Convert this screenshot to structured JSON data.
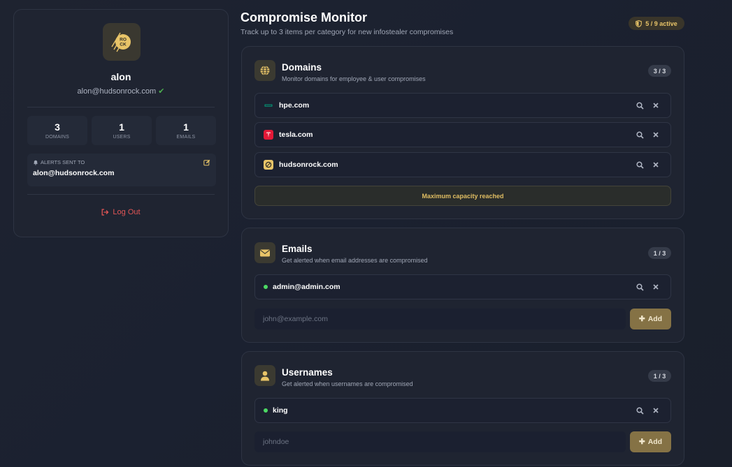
{
  "profile": {
    "name": "alon",
    "email": "alon@hudsonrock.com",
    "verified_icon": "check-icon",
    "logo_text": "ROCK",
    "stats": [
      {
        "value": "3",
        "label": "DOMAINS"
      },
      {
        "value": "1",
        "label": "USERS"
      },
      {
        "value": "1",
        "label": "EMAILS"
      }
    ],
    "alerts_label": "ALERTS SENT TO",
    "alerts_email": "alon@hudsonrock.com",
    "logout_label": "Log Out"
  },
  "header": {
    "title": "Compromise Monitor",
    "subtitle": "Track up to 3 items per category for new infostealer compromises",
    "active_badge": "5 / 9 active"
  },
  "domains": {
    "title": "Domains",
    "description": "Monitor domains for employee & user compromises",
    "count": "3 / 3",
    "items": [
      {
        "label": "hpe.com",
        "icon": "hpe-favicon"
      },
      {
        "label": "tesla.com",
        "icon": "tesla-favicon"
      },
      {
        "label": "hudsonrock.com",
        "icon": "hudsonrock-favicon"
      }
    ],
    "capacity_message": "Maximum capacity reached"
  },
  "emails": {
    "title": "Emails",
    "description": "Get alerted when email addresses are compromised",
    "count": "1 / 3",
    "items": [
      {
        "label": "admin@admin.com"
      }
    ],
    "input_placeholder": "john@example.com",
    "add_label": "Add"
  },
  "usernames": {
    "title": "Usernames",
    "description": "Get alerted when usernames are compromised",
    "count": "1 / 3",
    "items": [
      {
        "label": "king"
      }
    ],
    "input_placeholder": "johndoe",
    "add_label": "Add"
  },
  "colors": {
    "accent": "#e8c468",
    "danger": "#e05555",
    "success": "#4cd964",
    "background": "#1b2130",
    "card": "#1f2431"
  }
}
